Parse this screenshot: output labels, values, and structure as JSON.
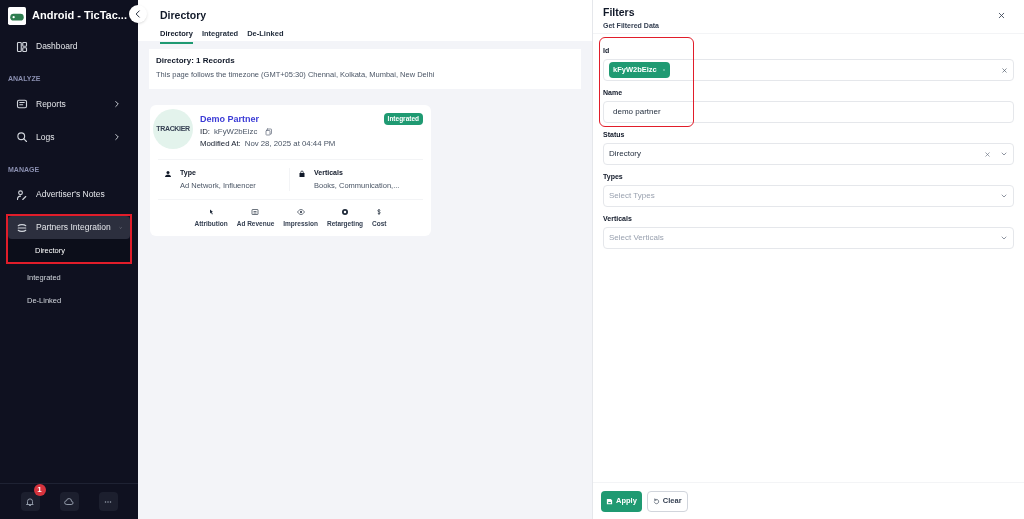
{
  "sidebar": {
    "app_name": "Android - TicTac...",
    "items": [
      {
        "kind": "item",
        "label": "Dashboard",
        "selected": false,
        "has_arrow": false
      },
      {
        "kind": "section",
        "label": "ANALYZE"
      },
      {
        "kind": "item",
        "label": "Reports",
        "has_arrow": true,
        "expanded": false,
        "selected": false
      },
      {
        "kind": "item",
        "label": "Logs",
        "has_arrow": true,
        "expanded": false,
        "selected": false
      },
      {
        "kind": "section",
        "label": "MANAGE"
      },
      {
        "kind": "item",
        "label": "Advertiser's Notes",
        "has_arrow": false,
        "selected": false
      },
      {
        "kind": "item",
        "label": "Partners Integration",
        "has_arrow": true,
        "expanded": true,
        "selected": true,
        "highlighted": true,
        "children": [
          {
            "label": "Directory",
            "selected": true
          },
          {
            "label": "Integrated",
            "selected": false
          },
          {
            "label": "De-Linked",
            "selected": false
          }
        ]
      }
    ],
    "notification_count": "1"
  },
  "page": {
    "title": "Directory",
    "tabs": [
      {
        "label": "Directory",
        "selected": true
      },
      {
        "label": "Integrated",
        "selected": false
      },
      {
        "label": "De-Linked",
        "selected": false
      }
    ],
    "summary": {
      "heading": "Directory: 1 Records",
      "note": "This page follows the timezone (GMT+05:30) Chennai, Kolkata, Mumbai, New Delhi"
    },
    "partners": [
      {
        "name": "Demo Partner",
        "logo_text": "TRACKIER",
        "status": "Integrated",
        "id_label": "ID:",
        "id": "kFyW2bEizc",
        "modified_label": "Modified At:",
        "modified": "Nov 28, 2025 at 04:44 PM",
        "type_label": "Type",
        "type": "Ad Network, Influencer",
        "verticals_label": "Verticals",
        "verticals": "Books, Communication,...",
        "features": [
          "Attribution",
          "Ad Revenue",
          "Impression",
          "Retargeting",
          "Cost"
        ]
      }
    ]
  },
  "filters": {
    "title": "Filters",
    "subtitle": "Get Filtered Data",
    "highlighted": true,
    "fields": [
      {
        "kind": "tags",
        "label": "Id",
        "tags": [
          "kFyW2bEizc"
        ]
      },
      {
        "kind": "text",
        "label": "Name",
        "value": "demo partner"
      },
      {
        "kind": "select",
        "label": "Status",
        "value": "Directory"
      },
      {
        "kind": "select",
        "label": "Types",
        "placeholder": "Select Types"
      },
      {
        "kind": "select",
        "label": "Verticals",
        "placeholder": "Select Verticals"
      }
    ],
    "buttons": [
      {
        "label": "Apply",
        "kind": "primary"
      },
      {
        "label": "Clear",
        "kind": "secondary"
      }
    ]
  }
}
